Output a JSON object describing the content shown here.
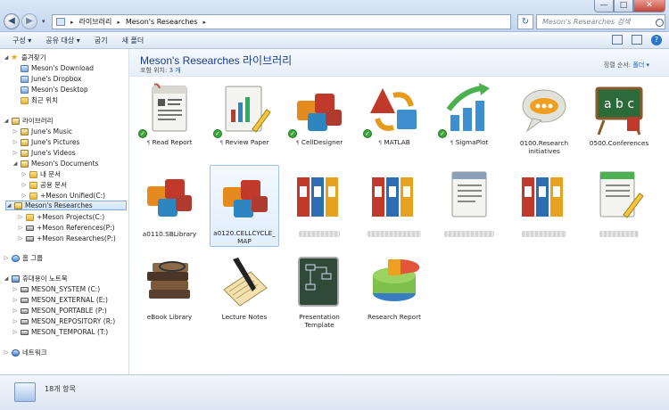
{
  "window": {
    "minimize": "—",
    "maximize": "□",
    "close": "✕"
  },
  "address": {
    "back": "◀",
    "forward": "▶",
    "crumbs": [
      "라이브러리",
      "Meson's Researches"
    ],
    "separator": "▸",
    "refresh": "↻",
    "search_placeholder": "Meson's Researches 검색"
  },
  "toolbar": {
    "organize": "구성 ▾",
    "share": "공유 대상 ▾",
    "burn": "굽기",
    "new_folder": "새 폴더",
    "help": "?"
  },
  "sidebar": {
    "favorites": {
      "label": "즐겨찾기",
      "items": [
        "Meson's Download",
        "June's Dropbox",
        "Meson's Desktop",
        "최근 위치"
      ]
    },
    "libraries": {
      "label": "라이브러리",
      "items": [
        "June's Music",
        "June's Pictures",
        "June's Videos",
        "Meson's Documents"
      ],
      "doc_children": [
        "내 문서",
        "공용 문서",
        "+Meson Unified(C:)"
      ],
      "selected": "Meson's Researches",
      "res_children": [
        "+Meson Projects(C:)",
        "+Meson References(P:)",
        "+Meson Researches(P:)"
      ]
    },
    "homegroup": "홈 그룹",
    "computer": {
      "label": "휴대용이 노트북",
      "drives": [
        "MESON_SYSTEM (C:)",
        "MESON_EXTERNAL (E:)",
        "MESON_PORTABLE (P:)",
        "MESON_REPOSITORY (R:)",
        "MESON_TEMPORAL (T:)"
      ]
    },
    "network": "네트워크"
  },
  "library": {
    "title": "Meson's Researches 라이브러리",
    "includes_label": "포함 위치:",
    "includes_count": "3 개",
    "sort_label": "정렬 순서:",
    "sort_value": "폴더 ▾"
  },
  "items": [
    {
      "label": "Read Report",
      "sync": true,
      "pin": true
    },
    {
      "label": "Review Paper",
      "sync": true,
      "pin": true
    },
    {
      "label": "CellDesigner",
      "sync": true,
      "pin": true
    },
    {
      "label": "MATLAB",
      "sync": true,
      "pin": true
    },
    {
      "label": "SigmaPlot",
      "sync": true,
      "pin": true
    },
    {
      "label": "0100.Research initiatives"
    },
    {
      "label": "0500.Conferences"
    },
    {
      "label": "a0110.SBLibrary"
    },
    {
      "label": "a0120.CELLCYCLE_MAP",
      "selected": true
    },
    {
      "label": ""
    },
    {
      "label": ""
    },
    {
      "label": ""
    },
    {
      "label": ""
    },
    {
      "label": ""
    },
    {
      "label": "eBook Library"
    },
    {
      "label": "Lecture Notes"
    },
    {
      "label": "Presentation Template"
    },
    {
      "label": "Research Report"
    }
  ],
  "status": {
    "count": "18개 항목"
  },
  "colors": {
    "title": "#1d3b8a",
    "accent": "#1d5bb8",
    "check": "#3aa63a"
  }
}
